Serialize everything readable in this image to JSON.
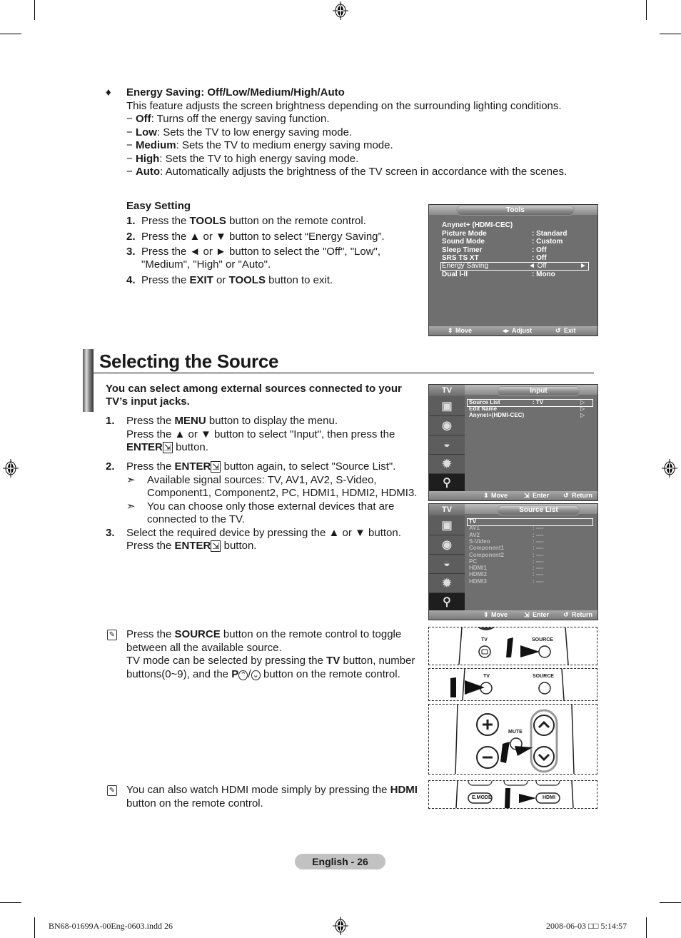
{
  "energy_saving": {
    "bullet": "♦",
    "heading": "Energy Saving:  Off/Low/Medium/High/Auto",
    "description": "This feature adjusts the screen brightness depending on the surrounding lighting conditions.",
    "options": [
      {
        "dash": "−",
        "name": "Off",
        "text": ": Turns off the energy saving function."
      },
      {
        "dash": "−",
        "name": "Low",
        "text": ": Sets the TV to low energy saving mode."
      },
      {
        "dash": "−",
        "name": "Medium",
        "text": ": Sets the TV to medium energy saving mode."
      },
      {
        "dash": "−",
        "name": "High",
        "text": ": Sets the TV to high energy saving mode."
      },
      {
        "dash": "−",
        "name": "Auto",
        "text": ": Automatically adjusts the brightness of the TV screen in accordance with the scenes."
      }
    ]
  },
  "easy_setting": {
    "heading": "Easy Setting",
    "steps": [
      {
        "num": "1.",
        "pre": "Press the ",
        "bold": "TOOLS",
        "post": " button on the remote control."
      },
      {
        "num": "2.",
        "pre": "Press the ▲ or ▼ button to select “Energy Saving”.",
        "bold": "",
        "post": ""
      },
      {
        "num": "3.",
        "pre": "Press the ◄ or ► button to select the \"Off\", \"Low\",",
        "bold": "",
        "post": "",
        "line2": "\"Medium\", \"High\" or \"Auto\"."
      },
      {
        "num": "4.",
        "pre": "Press the ",
        "bold": "EXIT",
        "mid": " or ",
        "bold2": "TOOLS",
        "post": " button to exit."
      }
    ]
  },
  "tools_osd": {
    "title": "Tools",
    "items": [
      {
        "label": "Anynet+ (HDMI-CEC)",
        "value": ""
      },
      {
        "label": "Picture Mode",
        "value": ": Standard"
      },
      {
        "label": "Sound Mode",
        "value": ": Custom"
      },
      {
        "label": "Sleep Timer",
        "value": ": Off"
      },
      {
        "label": "SRS TS XT",
        "value": ": Off"
      },
      {
        "label": "Energy Saving",
        "value": "◄ Off",
        "right_arrow": "►",
        "selected": true
      },
      {
        "label": "Dual I-II",
        "value": ": Mono"
      }
    ],
    "footer": {
      "move": "Move",
      "adjust": "Adjust",
      "exit": "Exit"
    }
  },
  "section": {
    "title": "Selecting the Source",
    "intro": "You can select among external sources connected to your TV’s input jacks.",
    "steps": {
      "s1_num": "1.",
      "s1_l1_pre": "Press the ",
      "s1_l1_bold": "MENU",
      "s1_l1_post": " button to display the menu.",
      "s1_l2": "Press the ▲ or ▼ button to select \"Input\", then press the",
      "s1_l3_bold": "ENTER",
      "s1_l3_post": " button.",
      "s2_num": "2.",
      "s2_pre": "Press the ",
      "s2_bold": "ENTER",
      "s2_post": " button again, to select \"Source List\".",
      "s2_note1_l1": "Available signal sources:  TV, AV1, AV2, S-Video,",
      "s2_note1_l2": "Component1, Component2, PC, HDMI1, HDMI2, HDMI3.",
      "s2_note2_l1": "You can choose only those external devices that are",
      "s2_note2_l2": "connected to the TV.",
      "note_arrow": "➣",
      "s3_num": "3.",
      "s3_l1": "Select the required device by pressing the ▲ or ▼ button.",
      "s3_l2_pre": "Press the ",
      "s3_l2_bold": "ENTER",
      "s3_l2_post": " button."
    },
    "note1": {
      "l1_pre": "Press the ",
      "l1_bold": "SOURCE",
      "l1_post": " button on the remote control to toggle",
      "l2": "between all the available source.",
      "l3_pre": "TV mode can be selected by pressing the ",
      "l3_bold": "TV",
      "l3_post": " button, number",
      "l4_pre": "buttons(0~9), and the ",
      "l4_bold": "P",
      "l4_post": " button on the remote control."
    },
    "note2": {
      "l1_pre": "You can also watch HDMI mode simply by pressing the ",
      "l1_bold": "HDMI",
      "l2": "button on the remote control."
    }
  },
  "input_osd": {
    "side_label": "TV",
    "title": "Input",
    "items": [
      {
        "label": "Source List",
        "value": ":  TV",
        "arrow": "▷",
        "selected": true
      },
      {
        "label": "Edit Name",
        "value": "",
        "arrow": "▷"
      },
      {
        "label": "Anynet+(HDMI-CEC)",
        "value": "",
        "arrow": "▷"
      }
    ],
    "footer": {
      "move": "Move",
      "enter": "Enter",
      "return": "Return"
    }
  },
  "source_list_osd": {
    "side_label": "TV",
    "title": "Source List",
    "items": [
      {
        "label": "TV",
        "value": "",
        "selected": true
      },
      {
        "label": "AV1",
        "value": ":  ----"
      },
      {
        "label": "AV2",
        "value": ":  ----"
      },
      {
        "label": "S-Video",
        "value": ":  ----"
      },
      {
        "label": "Component1",
        "value": ":  ----"
      },
      {
        "label": "Component2",
        "value": ":  ----"
      },
      {
        "label": "PC",
        "value": ":  ----"
      },
      {
        "label": "HDMI1",
        "value": ":  ----"
      },
      {
        "label": "HDMI2",
        "value": ":  ----"
      },
      {
        "label": "HDMI3",
        "value": ":  ----"
      }
    ],
    "footer": {
      "move": "Move",
      "enter": "Enter",
      "return": "Return"
    }
  },
  "remotes": {
    "tv": "TV",
    "source": "SOURCE",
    "mute": "MUTE",
    "emode": "E.MODE",
    "hdmi": "HDMI"
  },
  "page_number": "English - 26",
  "print_footer": {
    "file": "BN68-01699A-00Eng-0603.indd   26",
    "date": "2008-06-03   □□ 5:14:57"
  }
}
